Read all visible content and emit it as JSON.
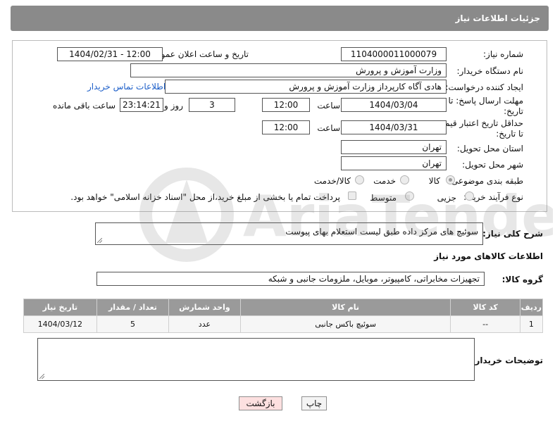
{
  "header": {
    "title": "جزئیات اطلاعات نیاز"
  },
  "form": {
    "need_number": {
      "label": "شماره نیاز:",
      "value": "1104000011000079"
    },
    "announce_date": {
      "label": "تاریخ و ساعت اعلان عمومی:",
      "value": "1404/02/31 - 12:00"
    },
    "buyer_org": {
      "label": "نام دستگاه خریدار:",
      "value": "وزارت آموزش و پرورش"
    },
    "requester": {
      "label": "ایجاد کننده درخواست:",
      "value": "هادی آگاه کارپرداز وزارت آموزش و پرورش",
      "contact_link": "اطلاعات تماس خریدار"
    },
    "reply_deadline": {
      "label_line1": "مهلت ارسال پاسخ: تا",
      "label_line2": "تاریخ:",
      "date": "1404/03/04",
      "time_label": "ساعت",
      "time": "12:00",
      "days": "3",
      "days_label": "روز و",
      "remaining": "23:14:21",
      "remaining_label": "ساعت باقی مانده"
    },
    "price_validity": {
      "label_line1": "حداقل تاریخ اعتبار قیمت:",
      "label_line2": "تا تاریخ:",
      "date": "1404/03/31",
      "time_label": "ساعت",
      "time": "12:00"
    },
    "delivery_province": {
      "label": "استان محل تحویل:",
      "value": "تهران"
    },
    "delivery_city": {
      "label": "شهر محل تحویل:",
      "value": "تهران"
    },
    "category": {
      "label": "طبقه بندی موضوعی:",
      "options": [
        "کالا",
        "خدمت",
        "کالا/خدمت"
      ],
      "selected": "کالا"
    },
    "process_type": {
      "label": "نوع فرآیند خرید :",
      "options": [
        "جزیی",
        "متوسط"
      ],
      "payment_note": "پرداخت تمام یا بخشی از مبلغ خرید،از محل \"اسناد خزانه اسلامی\" خواهد بود."
    }
  },
  "description": {
    "label": "شرح کلی نیاز:",
    "value": "سوئیچ های مرکز داده طبق لیست استعلام بهای پیوست"
  },
  "goods_section": {
    "title": "اطلاعات کالاهای مورد نیاز"
  },
  "goods_group": {
    "label": "گروه کالا:",
    "value": "تجهیزات مخابراتی، کامپیوتر، موبایل، ملزومات جانبی و شبکه"
  },
  "table": {
    "headers": [
      "ردیف",
      "کد کالا",
      "نام کالا",
      "واحد شمارش",
      "تعداد / مقدار",
      "تاریخ نیاز"
    ],
    "rows": [
      [
        "1",
        "--",
        "سوئیچ باکس جانبی",
        "عدد",
        "5",
        "1404/03/12"
      ]
    ]
  },
  "buyer_notes": {
    "label": "توضیحات خریدار:",
    "value": ""
  },
  "buttons": {
    "print": "چاپ",
    "back": "بازگشت"
  },
  "watermark": {
    "text": "AriaTender.net"
  }
}
